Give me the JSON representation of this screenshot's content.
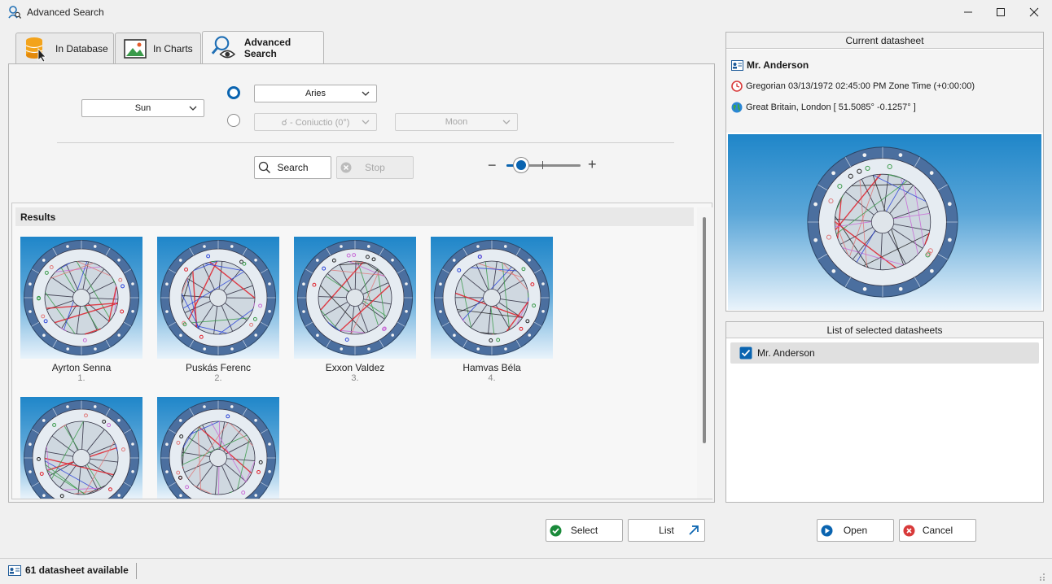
{
  "window": {
    "title": "Advanced Search",
    "icon": "search-user-icon",
    "controls": [
      "minimize-icon",
      "maximize-icon",
      "close-icon"
    ]
  },
  "tabs": [
    {
      "label": "In Database",
      "icon": "database-icon",
      "active": false
    },
    {
      "label": "In Charts",
      "icon": "image-icon",
      "active": false
    },
    {
      "label": "Advanced Search",
      "icon": "search-eye-icon",
      "active": true
    }
  ],
  "criteria": {
    "planet": "Sun",
    "sign_mode_selected": true,
    "sign": "Aries",
    "aspect": "☌ - Coniuctio (0°)",
    "aspect_planet": "Moon"
  },
  "buttons": {
    "search": "Search",
    "stop": "Stop",
    "select": "Select",
    "list": "List",
    "open": "Open",
    "cancel": "Cancel"
  },
  "zoom": {
    "minus": "−",
    "plus": "+",
    "level": 0.2
  },
  "results": {
    "header": "Results",
    "items": [
      {
        "name": "Ayrton Senna",
        "index": "1."
      },
      {
        "name": "Puskás Ferenc",
        "index": "2."
      },
      {
        "name": "Exxon Valdez",
        "index": "3."
      },
      {
        "name": "Hamvas Béla",
        "index": "4."
      },
      {
        "name": "",
        "index": ""
      },
      {
        "name": "",
        "index": ""
      }
    ]
  },
  "current_datasheet": {
    "title": "Current datasheet",
    "name": "Mr. Anderson",
    "datetime": "Gregorian  03/13/1972 02:45:00 PM  Zone Time (+0:00:00)",
    "location": "Great Britain, London  [ 51.5085°  -0.1257° ]"
  },
  "selected_list": {
    "title": "List of selected datasheets",
    "items": [
      {
        "label": "Mr. Anderson",
        "checked": true
      }
    ]
  },
  "status": {
    "text": "61 datasheet available"
  },
  "colors": {
    "accent": "#0a64b0",
    "chart_blue": "#1f86c9",
    "select_green": "#1a8a3a",
    "cancel_red": "#d83a3a"
  }
}
